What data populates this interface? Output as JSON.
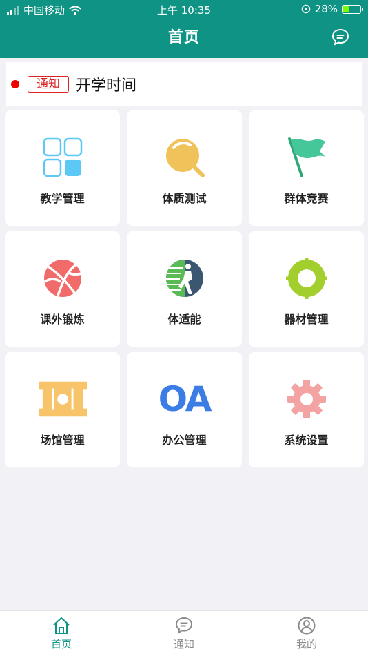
{
  "status_bar": {
    "carrier": "中国移动",
    "time": "上午 10:35",
    "battery": "28%"
  },
  "header": {
    "title": "首页",
    "accent_color": "#0e9384"
  },
  "notice": {
    "tag": "通知",
    "text": "开学时间",
    "tag_color": "#d22222"
  },
  "menu": [
    {
      "label": "教学管理",
      "icon": "grid-icon"
    },
    {
      "label": "体质测试",
      "icon": "magnifier-icon"
    },
    {
      "label": "群体竞赛",
      "icon": "flag-icon"
    },
    {
      "label": "课外锻炼",
      "icon": "basketball-icon"
    },
    {
      "label": "体适能",
      "icon": "runner-icon"
    },
    {
      "label": "器材管理",
      "icon": "ring-icon"
    },
    {
      "label": "场馆管理",
      "icon": "ticket-icon"
    },
    {
      "label": "办公管理",
      "icon": "oa-icon",
      "icon_text": "OA"
    },
    {
      "label": "系统设置",
      "icon": "gear-icon"
    }
  ],
  "tabbar": [
    {
      "label": "首页",
      "icon": "home-icon",
      "active": true
    },
    {
      "label": "通知",
      "icon": "chat-icon",
      "active": false
    },
    {
      "label": "我的",
      "icon": "user-icon",
      "active": false
    }
  ]
}
